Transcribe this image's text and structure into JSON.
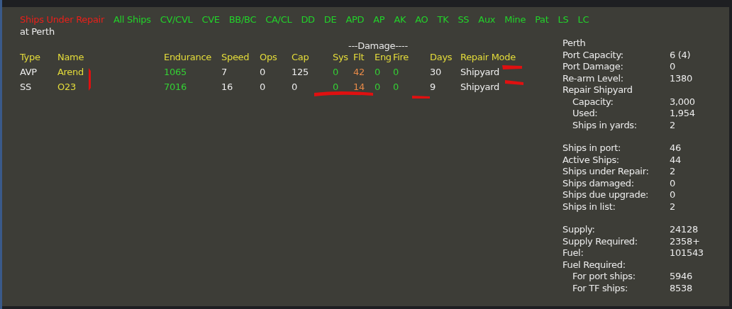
{
  "tabs": [
    {
      "label": "Ships Under Repair",
      "selected": true
    },
    {
      "label": "All Ships",
      "selected": false
    },
    {
      "label": "CV/CVL",
      "selected": false
    },
    {
      "label": "CVE",
      "selected": false
    },
    {
      "label": "BB/BC",
      "selected": false
    },
    {
      "label": "CA/CL",
      "selected": false
    },
    {
      "label": "DD",
      "selected": false
    },
    {
      "label": "DE",
      "selected": false
    },
    {
      "label": "APD",
      "selected": false
    },
    {
      "label": "AP",
      "selected": false
    },
    {
      "label": "AK",
      "selected": false
    },
    {
      "label": "AO",
      "selected": false
    },
    {
      "label": "TK",
      "selected": false
    },
    {
      "label": "SS",
      "selected": false
    },
    {
      "label": "Aux",
      "selected": false
    },
    {
      "label": "Mine",
      "selected": false
    },
    {
      "label": "Pat",
      "selected": false
    },
    {
      "label": "LS",
      "selected": false
    },
    {
      "label": "LC",
      "selected": false
    }
  ],
  "location": "at Perth",
  "table": {
    "group_header": "---Damage----",
    "columns": [
      {
        "label": "Type",
        "kind": "plain"
      },
      {
        "label": "Name",
        "kind": "name"
      },
      {
        "label": "Endurance",
        "kind": "good"
      },
      {
        "label": "Speed",
        "kind": "plain"
      },
      {
        "label": "Ops",
        "kind": "plain"
      },
      {
        "label": "Cap",
        "kind": "plain"
      },
      {
        "label": "Sys",
        "kind": "good"
      },
      {
        "label": "Flt",
        "kind": "warn"
      },
      {
        "label": "Eng",
        "kind": "good"
      },
      {
        "label": "Fire",
        "kind": "good"
      },
      {
        "label": "Days",
        "kind": "plain"
      },
      {
        "label": "Repair Mode",
        "kind": "plain"
      }
    ],
    "rows": [
      [
        "AVP",
        "Arend",
        "1065",
        "7",
        "0",
        "125",
        "0",
        "42",
        "0",
        "0",
        "30",
        "Shipyard"
      ],
      [
        "SS",
        "O23",
        "7016",
        "16",
        "0",
        "0",
        "0",
        "14",
        "0",
        "0",
        "9",
        "Shipyard"
      ]
    ]
  },
  "port": {
    "sections": [
      [
        {
          "label": "Perth"
        },
        {
          "label": "Port Capacity:",
          "value": "6 (4)"
        },
        {
          "label": "Port Damage:",
          "value": "0"
        },
        {
          "label": "Re-arm Level:",
          "value": "1380"
        },
        {
          "label": "Repair Shipyard",
          "children": [
            {
              "label": "Capacity:",
              "value": "3,000"
            },
            {
              "label": "Used:",
              "value": "1,954"
            },
            {
              "label": "Ships in yards:",
              "value": "2"
            }
          ]
        }
      ],
      [
        {
          "label": "Ships in port:",
          "value": "46"
        },
        {
          "label": "Active Ships:",
          "value": "44"
        },
        {
          "label": "Ships under Repair:",
          "value": "2"
        },
        {
          "label": "Ships damaged:",
          "value": "0"
        },
        {
          "label": "Ships due upgrade:",
          "value": "0"
        },
        {
          "label": "Ships in list:",
          "value": "2"
        }
      ],
      [
        {
          "label": "Supply:",
          "value": "24128"
        },
        {
          "label": "Supply Required:",
          "value": "2358+"
        },
        {
          "label": "Fuel:",
          "value": "101543"
        },
        {
          "label": "Fuel Required:",
          "children": [
            {
              "label": "For port ships:",
              "value": "5946"
            },
            {
              "label": "For TF ships:",
              "value": "8538"
            }
          ]
        }
      ]
    ]
  }
}
